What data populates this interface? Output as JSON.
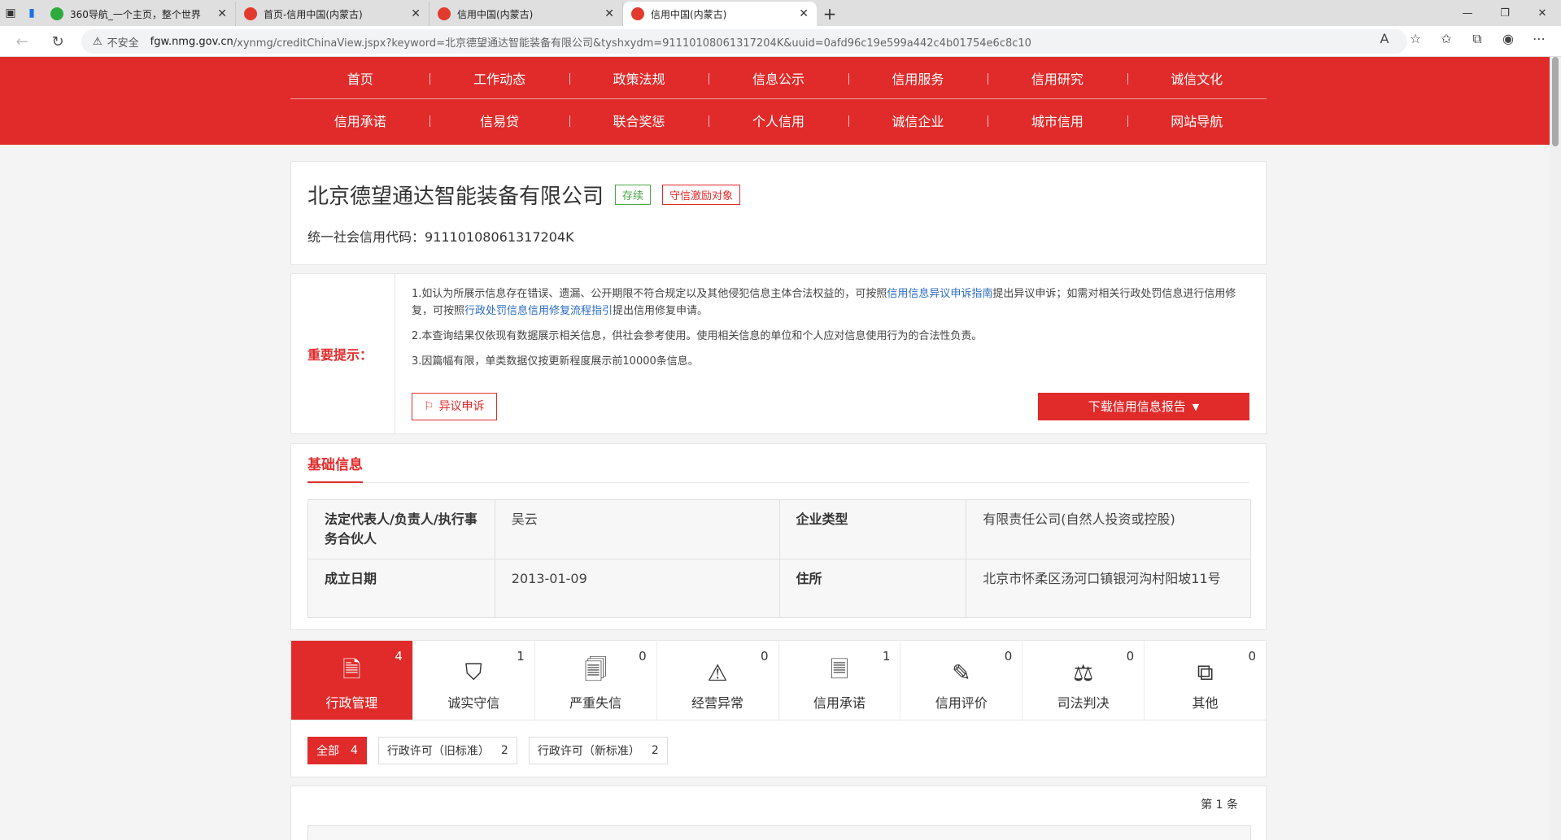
{
  "browser": {
    "tabs": [
      {
        "title": "360导航_一个主页，整个世界",
        "active": false
      },
      {
        "title": "首页-信用中国(内蒙古)",
        "active": false
      },
      {
        "title": "信用中国(内蒙古)",
        "active": false
      },
      {
        "title": "信用中国(内蒙古)",
        "active": true
      }
    ],
    "insecure_label": "不安全",
    "url_host": "fgw.nmg.gov.cn",
    "url_path": "/xynmg/creditChinaView.jspx?keyword=北京德望通达智能装备有限公司&tyshxydm=91110108061317204K&uuid=0afd96c19e599a442c4b01754e6c8c10"
  },
  "site_nav": {
    "row1": [
      "首页",
      "工作动态",
      "政策法规",
      "信息公示",
      "信用服务",
      "信用研究",
      "诚信文化"
    ],
    "row2": [
      "信用承诺",
      "信易贷",
      "联合奖惩",
      "个人信用",
      "诚信企业",
      "城市信用",
      "网站导航"
    ]
  },
  "company": {
    "name": "北京德望通达智能装备有限公司",
    "status_badge": "存续",
    "honor_badge": "守信激励对象",
    "code_label": "统一社会信用代码：",
    "code_value": "91110108061317204K"
  },
  "notice": {
    "title": "重要提示：",
    "line1_a": "1.如认为所展示信息存在错误、遗漏、公开期限不符合规定以及其他侵犯信息主体合法权益的，可按照",
    "line1_link1": "信用信息异议申诉指南",
    "line1_b": "提出异议申诉；如需对相关行政处罚信息进行信用修复，可按照",
    "line1_link2": "行政处罚信息信用修复流程指引",
    "line1_c": "提出信用修复申请。",
    "line2": "2.本查询结果仅依现有数据展示相关信息，供社会参考使用。使用相关信息的单位和个人应对信息使用行为的合法性负责。",
    "line3": "3.因篇幅有限，单类数据仅按更新程度展示前10000条信息。",
    "objection_button": "异议申诉",
    "download_button": "下载信用信息报告"
  },
  "basic": {
    "section_title": "基础信息",
    "rows": [
      {
        "k1": "法定代表人/负责人/执行事务合伙人",
        "v1": "吴云",
        "k2": "企业类型",
        "v2": "有限责任公司(自然人投资或控股)"
      },
      {
        "k1": "成立日期",
        "v1": "2013-01-09",
        "k2": "住所",
        "v2": "北京市怀柔区汤河口镇银河沟村阳坡11号"
      }
    ]
  },
  "categories": [
    {
      "label": "行政管理",
      "count": "4",
      "icon": "document-person-icon",
      "glyph": "🗎"
    },
    {
      "label": "诚实守信",
      "count": "1",
      "icon": "shield-credit-icon",
      "glyph": "⛉"
    },
    {
      "label": "严重失信",
      "count": "0",
      "icon": "dishonest-list-icon",
      "glyph": "🗐"
    },
    {
      "label": "经营异常",
      "count": "0",
      "icon": "alarm-light-icon",
      "glyph": "⚠"
    },
    {
      "label": "信用承诺",
      "count": "1",
      "icon": "pledge-document-icon",
      "glyph": "🗏"
    },
    {
      "label": "信用评价",
      "count": "0",
      "icon": "evaluation-edit-icon",
      "glyph": "✎"
    },
    {
      "label": "司法判决",
      "count": "0",
      "icon": "judgment-document-icon",
      "glyph": "⚖"
    },
    {
      "label": "其他",
      "count": "0",
      "icon": "other-files-icon",
      "glyph": "⧉"
    }
  ],
  "filters": [
    {
      "label": "全部",
      "count": "4",
      "active": true
    },
    {
      "label": "行政许可（旧标准）",
      "count": "2",
      "active": false
    },
    {
      "label": "行政许可（新标准）",
      "count": "2",
      "active": false
    }
  ],
  "records": {
    "page_info": "第 1 条"
  },
  "colors": {
    "brand_red": "#e12b2b",
    "status_green": "#4aa646",
    "link_blue": "#2b6cc4"
  }
}
